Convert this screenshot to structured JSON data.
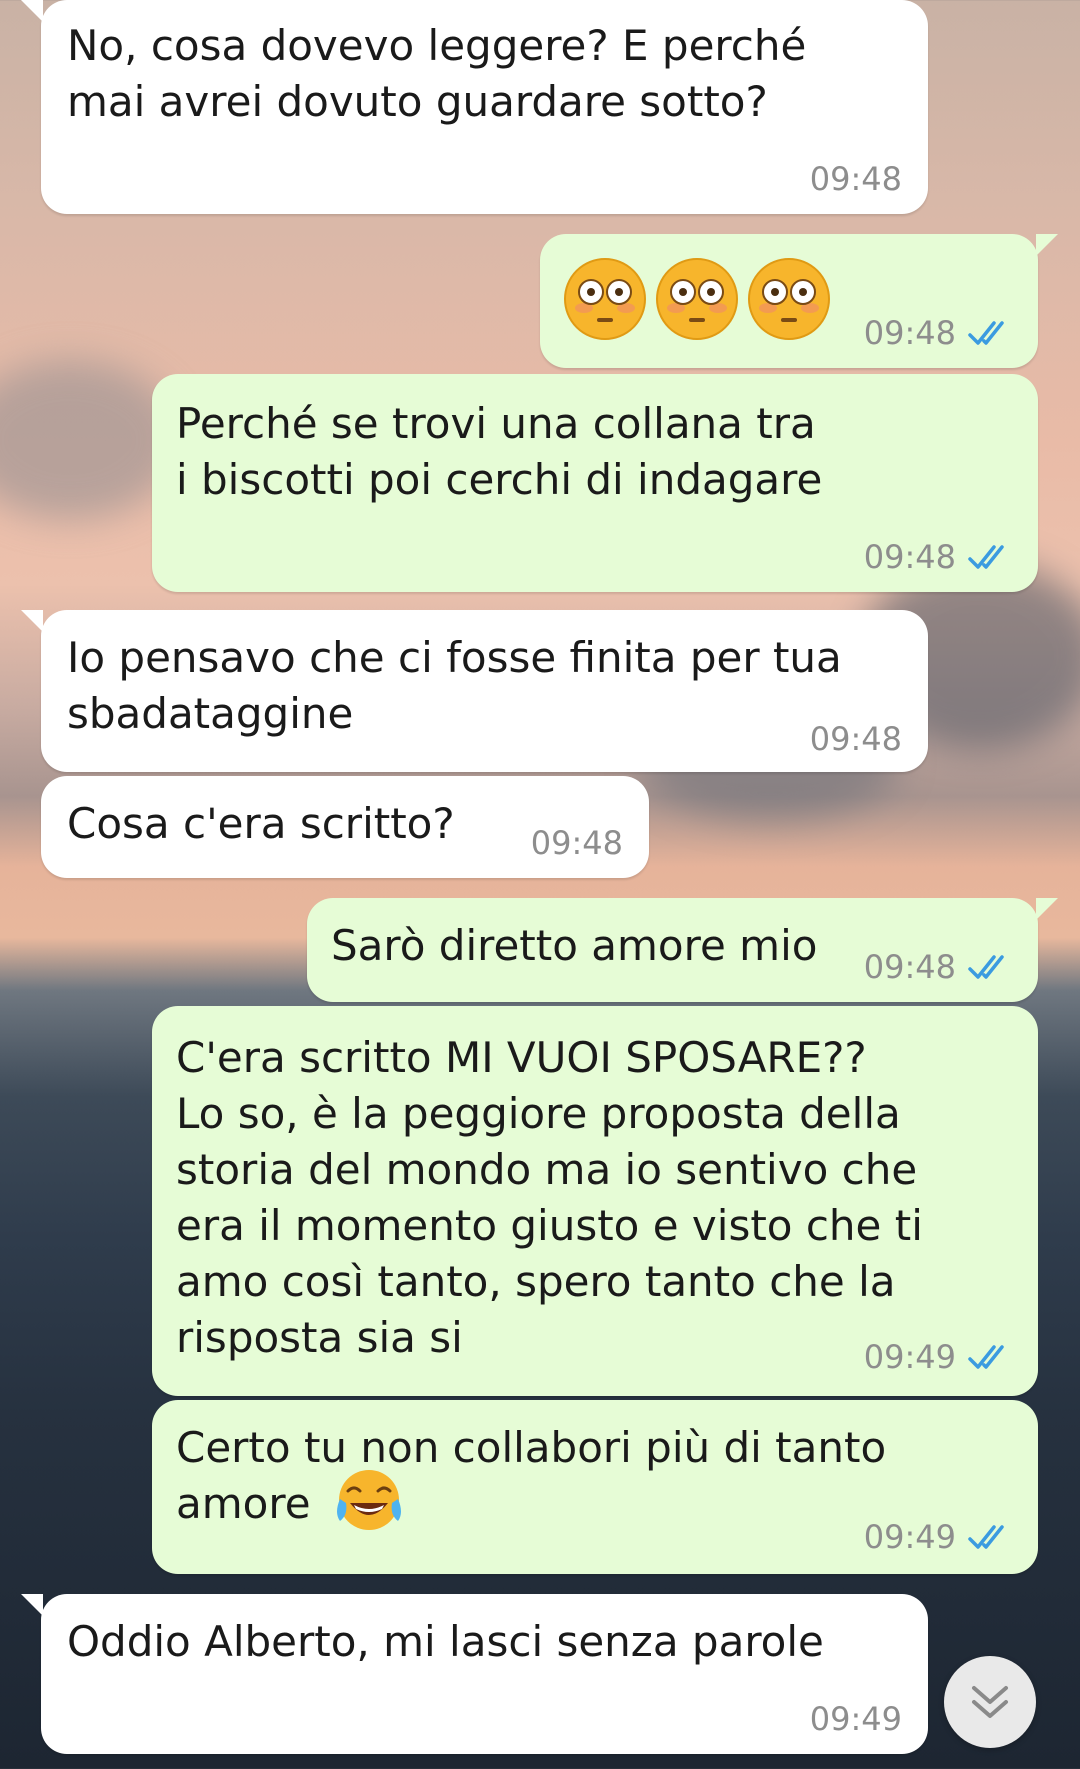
{
  "messages": [
    {
      "id": "m1",
      "direction": "in",
      "text": "No, cosa dovevo leggere? E perché\nmai avrei dovuto guardare sotto?",
      "time": "09:48"
    },
    {
      "id": "m2",
      "direction": "out",
      "emoji": "flushed-face x3",
      "time": "09:48",
      "status": "read"
    },
    {
      "id": "m3",
      "direction": "out",
      "text": "Perché se trovi una collana tra\ni biscotti poi cerchi di indagare",
      "time": "09:48",
      "status": "read"
    },
    {
      "id": "m4",
      "direction": "in",
      "text": "Io pensavo che ci fosse finita per tua\nsbadataggine",
      "time": "09:48"
    },
    {
      "id": "m5",
      "direction": "in",
      "text": "Cosa c'era scritto?",
      "time": "09:48"
    },
    {
      "id": "m6",
      "direction": "out",
      "text": "Sarò diretto amore mio",
      "time": "09:48",
      "status": "read"
    },
    {
      "id": "m7",
      "direction": "out",
      "text": "C'era scritto MI VUOI SPOSARE??\nLo so, è la peggiore proposta della\nstoria del mondo ma io sentivo che\nera il momento giusto e visto che ti\namo così tanto, spero tanto che la\nrisposta sia si",
      "time": "09:49",
      "status": "read"
    },
    {
      "id": "m8",
      "direction": "out",
      "text": "Certo tu non collabori più di tanto\namore",
      "emoji": "tears-of-joy",
      "time": "09:49",
      "status": "read"
    },
    {
      "id": "m9",
      "direction": "in",
      "text": "Oddio Alberto, mi lasci senza parole",
      "time": "09:49"
    }
  ],
  "colors": {
    "incoming_bubble": "#ffffff",
    "outgoing_bubble": "#e6fcd6",
    "read_ticks": "#3b9be0",
    "timestamp": "#8d8d8d"
  },
  "scroll_button": {
    "icon": "double-chevron-down-icon"
  }
}
